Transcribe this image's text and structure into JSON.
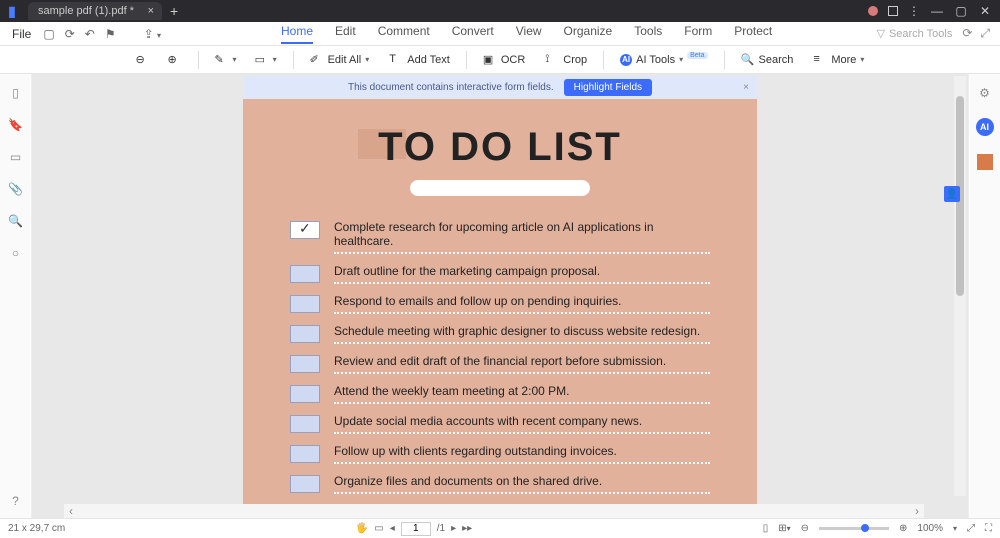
{
  "tab": {
    "title": "sample pdf (1).pdf *"
  },
  "menubar": {
    "file": "File",
    "tabs": [
      "Home",
      "Edit",
      "Comment",
      "Convert",
      "View",
      "Organize",
      "Tools",
      "Form",
      "Protect"
    ],
    "active": "Home",
    "search_placeholder": "Search Tools"
  },
  "toolbar": {
    "edit_all": "Edit All",
    "add_text": "Add Text",
    "ocr": "OCR",
    "crop": "Crop",
    "ai_tools": "AI Tools",
    "ai_beta": "Beta",
    "search": "Search",
    "more": "More"
  },
  "info_strip": {
    "text": "This document contains interactive form fields.",
    "button": "Highlight Fields"
  },
  "document": {
    "title": "TO DO LIST",
    "items": [
      {
        "checked": true,
        "text": "Complete research for upcoming article on AI applications in healthcare."
      },
      {
        "checked": false,
        "text": "Draft outline for the marketing campaign proposal."
      },
      {
        "checked": false,
        "text": "Respond to emails and follow up on pending inquiries."
      },
      {
        "checked": false,
        "text": "Schedule meeting with graphic designer to discuss website redesign."
      },
      {
        "checked": false,
        "text": "Review and edit draft of the financial report before submission."
      },
      {
        "checked": false,
        "text": "Attend the weekly team meeting at 2:00 PM."
      },
      {
        "checked": false,
        "text": "Update social media accounts with recent company news."
      },
      {
        "checked": false,
        "text": "Follow up with clients regarding outstanding invoices."
      },
      {
        "checked": false,
        "text": "Organize files and documents on the shared drive."
      }
    ]
  },
  "status": {
    "dims": "21 x 29,7 cm",
    "page_current": "1",
    "page_total": "/1",
    "zoom": "100%"
  }
}
